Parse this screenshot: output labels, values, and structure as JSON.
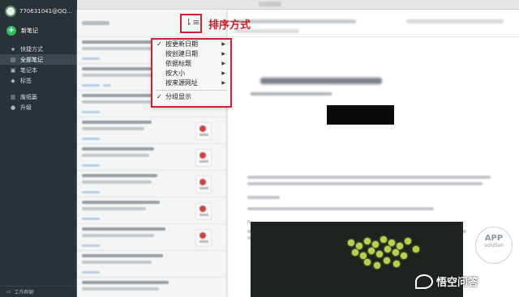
{
  "account": {
    "name": "770631041@QQ...",
    "chevron_icon": "chevron-down-icon"
  },
  "sidebar": {
    "new_note_label": "新笔记",
    "items": [
      {
        "label": "快捷方式",
        "icon": "star-icon"
      },
      {
        "label": "全部笔记",
        "icon": "note-icon",
        "active": true
      },
      {
        "label": "笔记本",
        "icon": "notebook-icon"
      },
      {
        "label": "标签",
        "icon": "tag-icon"
      },
      {
        "label": "废纸篓",
        "icon": "trash-icon"
      },
      {
        "label": "升级",
        "icon": "upgrade-icon"
      }
    ],
    "footer_label": "工作群聊"
  },
  "annotation": {
    "sort_label": "排序方式"
  },
  "sort_menu": {
    "items": [
      {
        "label": "按更新日期",
        "checked": true,
        "submenu": true
      },
      {
        "label": "按创建日期",
        "checked": false,
        "submenu": true
      },
      {
        "label": "依据标题",
        "checked": false,
        "submenu": true
      },
      {
        "label": "按大小",
        "checked": false,
        "submenu": true
      },
      {
        "label": "按来源网址",
        "checked": false,
        "submenu": true
      }
    ],
    "group_label": "分组显示",
    "group_checked": true
  },
  "watermark": {
    "circle_top": "APP",
    "circle_bottom": "solution",
    "brand": "悟空问答"
  },
  "colors": {
    "sidebar_bg": "#2a3137",
    "accent_green": "#2dbe60",
    "annotation_red": "#cc2233"
  }
}
